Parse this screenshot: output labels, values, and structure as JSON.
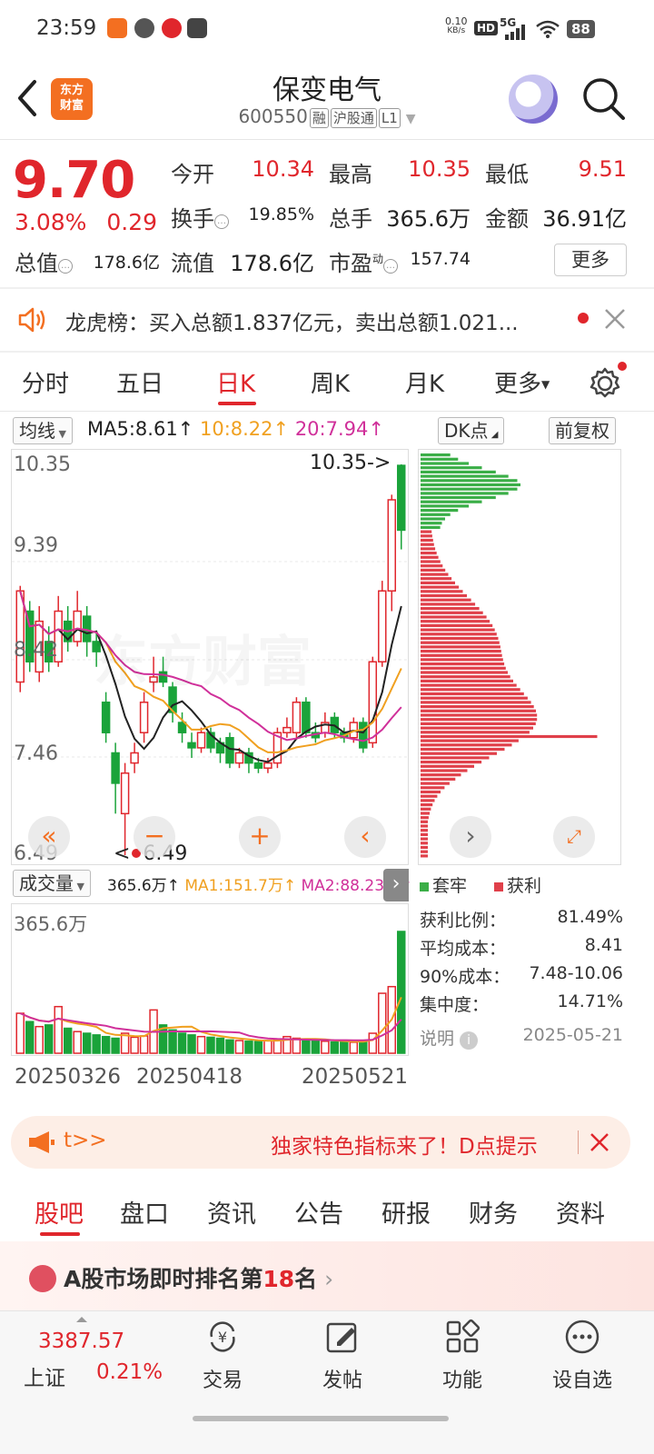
{
  "status_bar": {
    "time": "23:59",
    "net_speed_value": "0.10",
    "net_speed_unit": "KB/s",
    "hd": "HD",
    "signal": "5G",
    "battery": "88"
  },
  "header": {
    "logo_line1": "东方",
    "logo_line2": "财富",
    "title": "保变电气",
    "code": "600550",
    "tags": [
      "融",
      "沪股通",
      "L1"
    ]
  },
  "quote": {
    "price": "9.70",
    "change_pct": "3.08%",
    "change_amt": "0.29",
    "fields": [
      {
        "label": "今开",
        "value": "10.34"
      },
      {
        "label": "最高",
        "value": "10.35"
      },
      {
        "label": "最低",
        "value": "9.51"
      },
      {
        "label": "换手",
        "value": "19.85%"
      },
      {
        "label": "总手",
        "value": "365.6万"
      },
      {
        "label": "金额",
        "value": "36.91亿"
      },
      {
        "label": "总值",
        "value": "178.6亿"
      },
      {
        "label": "流值",
        "value": "178.6亿"
      },
      {
        "label": "市盈",
        "value": "157.74"
      }
    ],
    "pe_sup": "动",
    "more_label": "更多"
  },
  "notice": {
    "text": "龙虎榜：买入总额1.837亿元，卖出总额1.021..."
  },
  "kline_tabs": [
    {
      "label": "分时"
    },
    {
      "label": "五日"
    },
    {
      "label": "日K"
    },
    {
      "label": "周K"
    },
    {
      "label": "月K"
    },
    {
      "label": "更多"
    }
  ],
  "ma_bar": {
    "selector": "均线",
    "ma5": "MA5:8.61↑",
    "ma10": "10:8.22↑",
    "ma20": "20:7.94↑",
    "dk_label": "DK点",
    "adjust_label": "前复权",
    "colors": {
      "ma5": "#222222",
      "ma10": "#f0a020",
      "ma20": "#d0309a"
    }
  },
  "chart_data": [
    {
      "type": "candlestick",
      "ylim": [
        6.49,
        10.35
      ],
      "y_ticks": [
        "10.35",
        "9.39",
        "8.42",
        "7.46",
        "6.49"
      ],
      "x_ticks": [
        "20250326",
        "20250418",
        "20250521"
      ],
      "annotations": {
        "high_marker": "10.35->",
        "low_marker": "6.49"
      },
      "candles": [
        {
          "o": 8.2,
          "c": 9.1,
          "h": 9.15,
          "l": 8.1
        },
        {
          "o": 8.9,
          "c": 8.4,
          "h": 9.0,
          "l": 8.3
        },
        {
          "o": 8.3,
          "c": 8.8,
          "h": 8.95,
          "l": 8.2
        },
        {
          "o": 8.6,
          "c": 8.4,
          "h": 8.75,
          "l": 8.3
        },
        {
          "o": 8.4,
          "c": 8.9,
          "h": 9.05,
          "l": 8.35
        },
        {
          "o": 8.8,
          "c": 8.6,
          "h": 8.95,
          "l": 8.5
        },
        {
          "o": 8.6,
          "c": 8.9,
          "h": 9.1,
          "l": 8.55
        },
        {
          "o": 8.85,
          "c": 8.6,
          "h": 8.95,
          "l": 8.45
        },
        {
          "o": 8.6,
          "c": 8.5,
          "h": 8.7,
          "l": 8.35
        },
        {
          "o": 8.0,
          "c": 7.7,
          "h": 8.1,
          "l": 7.6
        },
        {
          "o": 7.5,
          "c": 7.2,
          "h": 7.6,
          "l": 6.9
        },
        {
          "o": 6.9,
          "c": 7.3,
          "h": 7.4,
          "l": 6.49
        },
        {
          "o": 7.4,
          "c": 7.5,
          "h": 7.6,
          "l": 7.3
        },
        {
          "o": 7.7,
          "c": 8.0,
          "h": 8.1,
          "l": 7.6
        },
        {
          "o": 8.2,
          "c": 8.25,
          "h": 8.45,
          "l": 8.1
        },
        {
          "o": 8.3,
          "c": 8.2,
          "h": 8.45,
          "l": 8.15
        },
        {
          "o": 8.15,
          "c": 7.9,
          "h": 8.2,
          "l": 7.8
        },
        {
          "o": 7.8,
          "c": 7.7,
          "h": 7.9,
          "l": 7.6
        },
        {
          "o": 7.6,
          "c": 7.55,
          "h": 7.7,
          "l": 7.45
        },
        {
          "o": 7.55,
          "c": 7.7,
          "h": 7.75,
          "l": 7.5
        },
        {
          "o": 7.7,
          "c": 7.55,
          "h": 7.75,
          "l": 7.5
        },
        {
          "o": 7.6,
          "c": 7.5,
          "h": 7.65,
          "l": 7.4
        },
        {
          "o": 7.65,
          "c": 7.4,
          "h": 7.7,
          "l": 7.35
        },
        {
          "o": 7.4,
          "c": 7.5,
          "h": 7.55,
          "l": 7.35
        },
        {
          "o": 7.5,
          "c": 7.4,
          "h": 7.55,
          "l": 7.3
        },
        {
          "o": 7.4,
          "c": 7.35,
          "h": 7.45,
          "l": 7.3
        },
        {
          "o": 7.35,
          "c": 7.4,
          "h": 7.45,
          "l": 7.3
        },
        {
          "o": 7.4,
          "c": 7.7,
          "h": 7.75,
          "l": 7.35
        },
        {
          "o": 7.7,
          "c": 7.75,
          "h": 7.85,
          "l": 7.65
        },
        {
          "o": 7.7,
          "c": 8.0,
          "h": 8.05,
          "l": 7.65
        },
        {
          "o": 8.0,
          "c": 7.7,
          "h": 8.05,
          "l": 7.65
        },
        {
          "o": 7.7,
          "c": 7.65,
          "h": 7.8,
          "l": 7.6
        },
        {
          "o": 7.7,
          "c": 7.8,
          "h": 7.9,
          "l": 7.65
        },
        {
          "o": 7.85,
          "c": 7.7,
          "h": 7.9,
          "l": 7.65
        },
        {
          "o": 7.7,
          "c": 7.65,
          "h": 7.75,
          "l": 7.6
        },
        {
          "o": 7.65,
          "c": 7.8,
          "h": 7.85,
          "l": 7.6
        },
        {
          "o": 7.8,
          "c": 7.55,
          "h": 7.85,
          "l": 7.5
        },
        {
          "o": 7.6,
          "c": 8.4,
          "h": 8.45,
          "l": 7.55
        },
        {
          "o": 8.4,
          "c": 9.1,
          "h": 9.2,
          "l": 8.35
        },
        {
          "o": 9.1,
          "c": 10.0,
          "h": 10.05,
          "l": 8.9
        },
        {
          "o": 10.34,
          "c": 9.7,
          "h": 10.35,
          "l": 9.51
        }
      ]
    },
    {
      "type": "bar",
      "title": "成交量",
      "total": "365.6万↑",
      "ma1": "MA1:151.7万↑",
      "ma2": "MA2:88.23万↑",
      "max_label": "365.6万",
      "values": [
        120,
        95,
        80,
        85,
        140,
        75,
        65,
        60,
        55,
        50,
        45,
        60,
        48,
        52,
        130,
        85,
        70,
        60,
        55,
        50,
        48,
        45,
        40,
        38,
        36,
        35,
        38,
        42,
        50,
        45,
        40,
        38,
        36,
        34,
        35,
        33,
        35,
        60,
        180,
        200,
        365.6
      ],
      "ylim": [
        0,
        365.6
      ]
    },
    {
      "type": "bar",
      "title": "筹码分布",
      "orientation": "horizontal",
      "legend": [
        {
          "name": "套牢",
          "color": "#3aae47"
        },
        {
          "name": "获利",
          "color": "#e0404a"
        }
      ]
    }
  ],
  "chips": {
    "legend_trapped": "套牢",
    "legend_profit": "获利",
    "rows": [
      {
        "label": "获利比例：",
        "value": "81.49%"
      },
      {
        "label": "平均成本：",
        "value": "8.41"
      },
      {
        "label": "90%成本：",
        "value": "7.48-10.06"
      },
      {
        "label": "集中度：",
        "value": "14.71%"
      }
    ],
    "note_label": "说明",
    "date": "2025-05-21"
  },
  "promo": {
    "left_text": "t>>",
    "text": "独家特色指标来了！D点提示"
  },
  "bottom_tabs": [
    {
      "label": "股吧"
    },
    {
      "label": "盘口"
    },
    {
      "label": "资讯"
    },
    {
      "label": "公告"
    },
    {
      "label": "研报"
    },
    {
      "label": "财务"
    },
    {
      "label": "资料"
    }
  ],
  "rank_banner": {
    "prefix": "A股市场即时排名第",
    "rank": "18",
    "suffix": "名"
  },
  "navbar": {
    "index_value": "3387.57",
    "index_name": "上证",
    "index_change": "0.21%",
    "items": [
      {
        "label": "交易",
        "icon": "yuan-exchange-icon"
      },
      {
        "label": "发帖",
        "icon": "edit-icon"
      },
      {
        "label": "功能",
        "icon": "grid-icon"
      },
      {
        "label": "设自选",
        "icon": "more-dots-icon"
      }
    ]
  }
}
